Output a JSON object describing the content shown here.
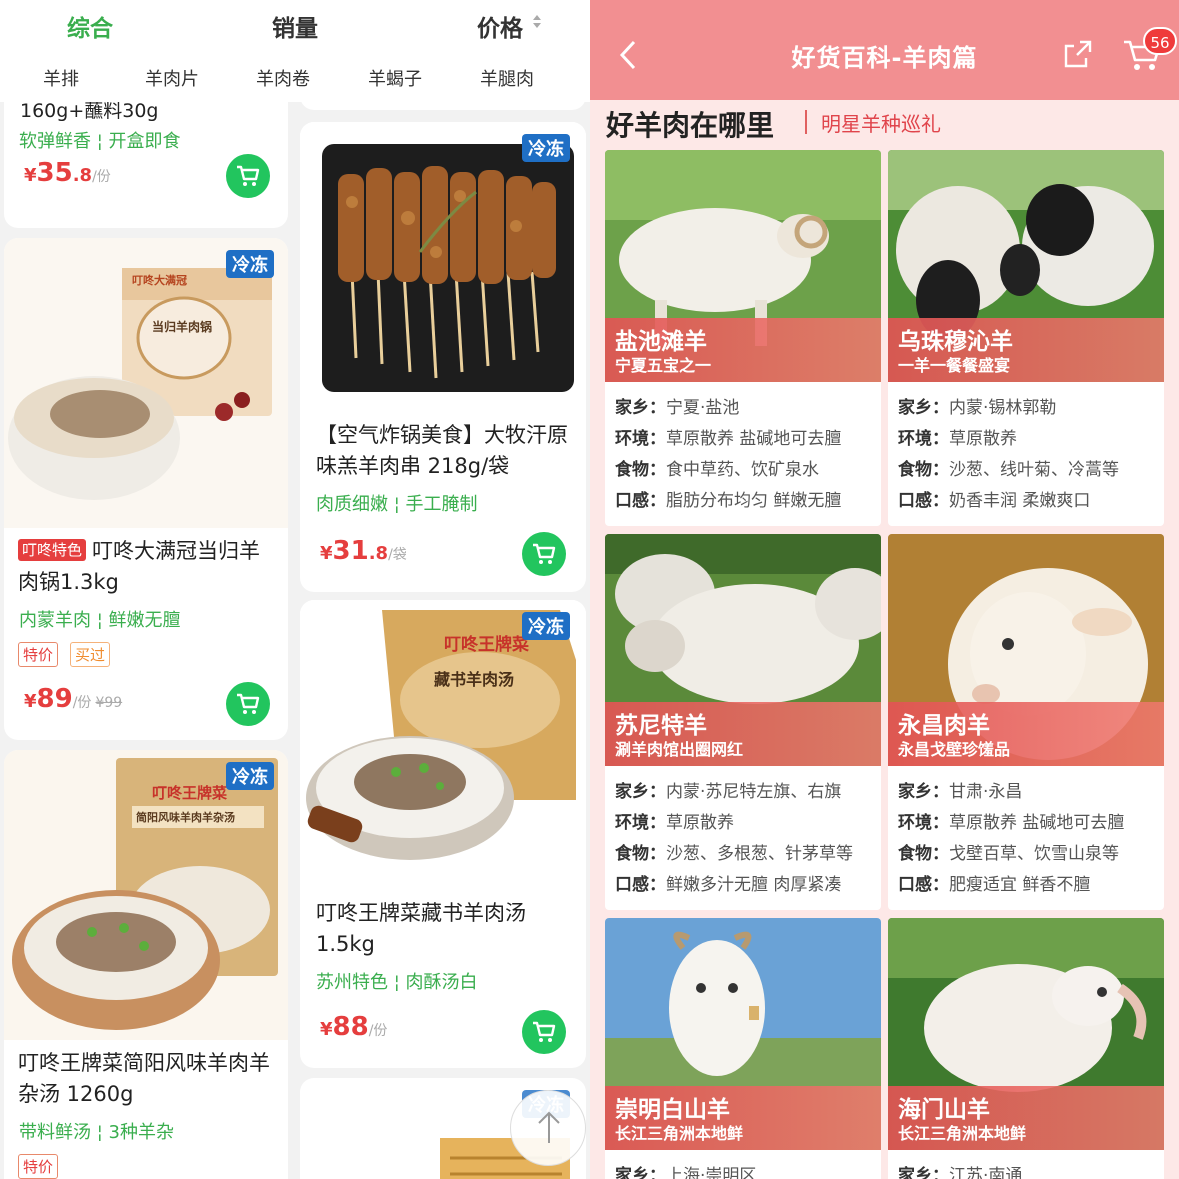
{
  "sort_bar": {
    "comprehensive": "综合",
    "sales": "销量",
    "price": "价格"
  },
  "subcategories": [
    "羊排",
    "羊肉片",
    "羊肉卷",
    "羊蝎子",
    "羊腿肉"
  ],
  "left_products": {
    "p1": {
      "title_fragment": "160g+蘸料30g",
      "desc": "软弹鲜香 ¦ 开盒即食",
      "price_yen": "¥",
      "price_int": "35",
      "price_dec": ".8",
      "unit": "/份"
    },
    "p2": {
      "frozen": "冷冻",
      "brand_tag": "叮咚特色",
      "title": "叮咚大满冠当归羊肉锅1.3kg",
      "desc": "内蒙羊肉 ¦ 鲜嫩无膻",
      "tag1": "特价",
      "tag2": "买过",
      "price_yen": "¥",
      "price_int": "89",
      "unit": "/份",
      "orig": "¥99",
      "pkg_brand": "叮咚大满冠",
      "pkg_name": "当归羊肉锅"
    },
    "p3": {
      "frozen": "冷冻",
      "title": "叮咚王牌菜简阳风味羊肉羊杂汤 1260g",
      "desc": "带料鲜汤 ¦ 3种羊杂",
      "tag1": "特价",
      "pkg_brand": "叮咚王牌菜",
      "pkg_name": "简阳风味羊肉羊杂汤"
    },
    "p4": {
      "frozen": "冷冻",
      "title": "【空气炸锅美食】大牧汗原味羔羊肉串 218g/袋",
      "desc": "肉质细嫩 ¦ 手工腌制",
      "price_yen": "¥",
      "price_int": "31",
      "price_dec": ".8",
      "unit": "/袋"
    },
    "p5": {
      "frozen": "冷冻",
      "title": "叮咚王牌菜藏书羊肉汤 1.5kg",
      "desc": "苏州特色 ¦ 肉酥汤白",
      "price_yen": "¥",
      "price_int": "88",
      "unit": "/份",
      "pkg_brand": "叮咚王牌菜",
      "pkg_name": "藏书羊肉汤"
    },
    "p6": {
      "frozen": "冷冻"
    }
  },
  "right_page": {
    "nav_title": "好货百科-羊肉篇",
    "cart_count": "56",
    "section_title": "好羊肉在哪里",
    "section_subtitle": "明星羊种巡礼",
    "labels": {
      "hometown": "家乡：",
      "env": "环境：",
      "food": "食物：",
      "taste": "口感："
    },
    "sheep": [
      {
        "name": "盐池滩羊",
        "slogan": "宁夏五宝之一",
        "hometown": "宁夏·盐池",
        "env": "草原散养 盐碱地可去膻",
        "food": "食中草药、饮矿泉水",
        "taste": "脂肪分布均匀 鲜嫩无膻"
      },
      {
        "name": "乌珠穆沁羊",
        "slogan": "一羊一餐餐盛宴",
        "hometown": "内蒙·锡林郭勒",
        "env": "草原散养",
        "food": "沙葱、线叶菊、冷蒿等",
        "taste": "奶香丰润 柔嫩爽口"
      },
      {
        "name": "苏尼特羊",
        "slogan": "涮羊肉馆出圈网红",
        "hometown": "内蒙·苏尼特左旗、右旗",
        "env": "草原散养",
        "food": "沙葱、多根葱、针茅草等",
        "taste": "鲜嫩多汁无膻 肉厚紧凑"
      },
      {
        "name": "永昌肉羊",
        "slogan": "永昌戈壁珍馐品",
        "hometown": "甘肃·永昌",
        "env": "草原散养 盐碱地可去膻",
        "food": "戈壁百草、饮雪山泉等",
        "taste": "肥瘦适宜 鲜香不膻"
      },
      {
        "name": "崇明白山羊",
        "slogan": "长江三角洲本地鲜",
        "hometown": "上海·崇明区"
      },
      {
        "name": "海门山羊",
        "slogan": "长江三角洲本地鲜",
        "hometown": "江苏·南通"
      }
    ]
  },
  "colors": {
    "green": "#3aae4e",
    "cart_green": "#22c55e",
    "price_red": "#e53e3e",
    "frozen_blue": "#1f6fc5",
    "nav_pink": "#f28f91",
    "band_red": "#e25454"
  }
}
